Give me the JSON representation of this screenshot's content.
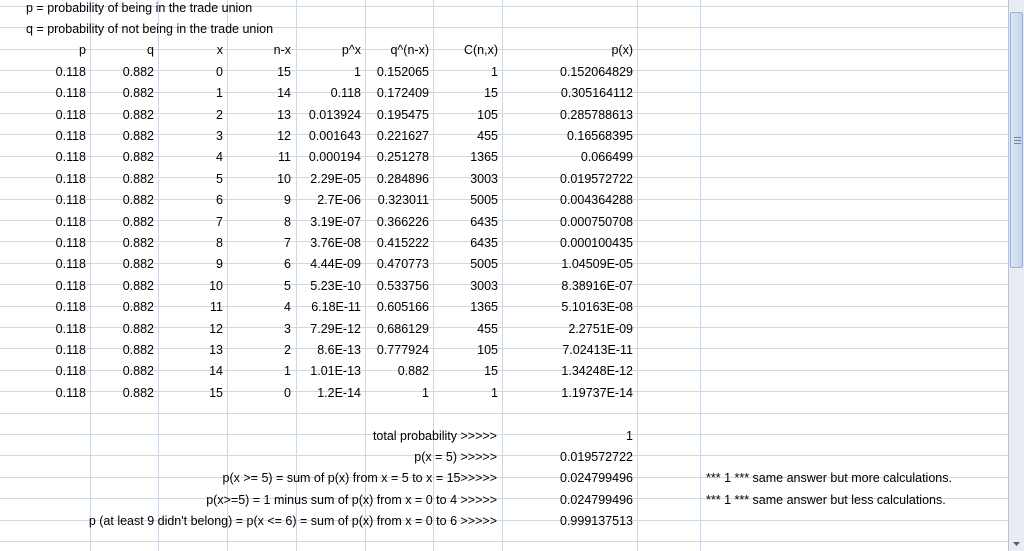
{
  "notes": {
    "p_def": "p = probability of being in the trade union",
    "q_def": "q = probability of not being in the trade union"
  },
  "headers": [
    "p",
    "q",
    "x",
    "n-x",
    "p^x",
    "q^(n-x)",
    "C(n,x)",
    "p(x)"
  ],
  "rows": [
    [
      "0.118",
      "0.882",
      "0",
      "15",
      "1",
      "0.152065",
      "1",
      "0.152064829"
    ],
    [
      "0.118",
      "0.882",
      "1",
      "14",
      "0.118",
      "0.172409",
      "15",
      "0.305164112"
    ],
    [
      "0.118",
      "0.882",
      "2",
      "13",
      "0.013924",
      "0.195475",
      "105",
      "0.285788613"
    ],
    [
      "0.118",
      "0.882",
      "3",
      "12",
      "0.001643",
      "0.221627",
      "455",
      "0.16568395"
    ],
    [
      "0.118",
      "0.882",
      "4",
      "11",
      "0.000194",
      "0.251278",
      "1365",
      "0.066499"
    ],
    [
      "0.118",
      "0.882",
      "5",
      "10",
      "2.29E-05",
      "0.284896",
      "3003",
      "0.019572722"
    ],
    [
      "0.118",
      "0.882",
      "6",
      "9",
      "2.7E-06",
      "0.323011",
      "5005",
      "0.004364288"
    ],
    [
      "0.118",
      "0.882",
      "7",
      "8",
      "3.19E-07",
      "0.366226",
      "6435",
      "0.000750708"
    ],
    [
      "0.118",
      "0.882",
      "8",
      "7",
      "3.76E-08",
      "0.415222",
      "6435",
      "0.000100435"
    ],
    [
      "0.118",
      "0.882",
      "9",
      "6",
      "4.44E-09",
      "0.470773",
      "5005",
      "1.04509E-05"
    ],
    [
      "0.118",
      "0.882",
      "10",
      "5",
      "5.23E-10",
      "0.533756",
      "3003",
      "8.38916E-07"
    ],
    [
      "0.118",
      "0.882",
      "11",
      "4",
      "6.18E-11",
      "0.605166",
      "1365",
      "5.10163E-08"
    ],
    [
      "0.118",
      "0.882",
      "12",
      "3",
      "7.29E-12",
      "0.686129",
      "455",
      "2.2751E-09"
    ],
    [
      "0.118",
      "0.882",
      "13",
      "2",
      "8.6E-13",
      "0.777924",
      "105",
      "7.02413E-11"
    ],
    [
      "0.118",
      "0.882",
      "14",
      "1",
      "1.01E-13",
      "0.882",
      "15",
      "1.34248E-12"
    ],
    [
      "0.118",
      "0.882",
      "15",
      "0",
      "1.2E-14",
      "1",
      "1",
      "1.19737E-14"
    ]
  ],
  "summary": [
    {
      "label": "total probability >>>>>",
      "value": "1",
      "note": ""
    },
    {
      "label": "p(x = 5) >>>>>",
      "value": "0.019572722",
      "note": ""
    },
    {
      "label": "p(x >= 5) = sum of p(x) from x = 5 to x = 15>>>>>",
      "value": "0.024799496",
      "note": "*** 1 *** same answer but more calculations."
    },
    {
      "label": "p(x>=5) = 1 minus sum of p(x) from x = 0 to 4 >>>>>",
      "value": "0.024799496",
      "note": "*** 1 *** same answer but less calculations."
    },
    {
      "label": "p (at least 9 didn't belong) = p(x <= 6) = sum of p(x) from x = 0 to 6 >>>>>",
      "value": "0.999137513",
      "note": ""
    }
  ]
}
